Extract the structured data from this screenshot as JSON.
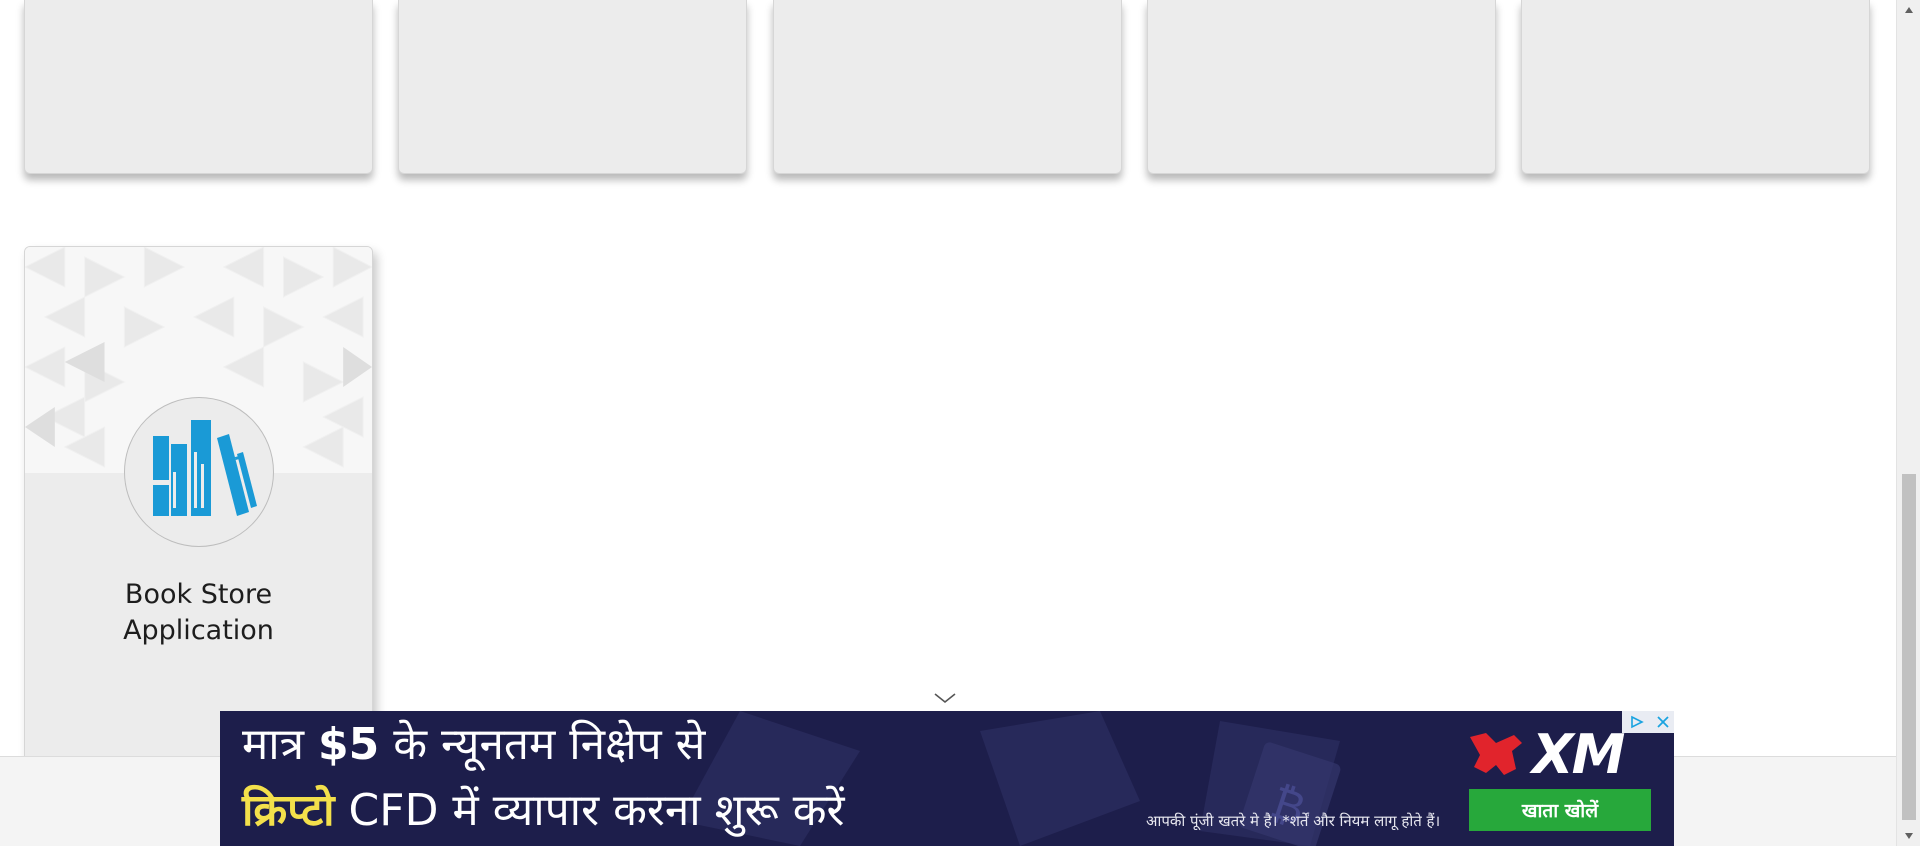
{
  "cards_top_row": [
    {
      "id": "card-1"
    },
    {
      "id": "card-2"
    },
    {
      "id": "card-3"
    },
    {
      "id": "card-4"
    },
    {
      "id": "card-5"
    }
  ],
  "book_card": {
    "title_line1": "Book Store",
    "title_line2": "Application",
    "icon": "books-icon",
    "icon_color": "#1a9ad6"
  },
  "ad": {
    "line1_prefix": "मात्र ",
    "line1_amount": "$5",
    "line1_suffix": " के न्यूनतम निक्षेप से",
    "line2_crypto": "क्रिप्टो",
    "line2_rest": " CFD में  व्यापार करना शुरू करें",
    "risk_text": "आपकी पूंजी खतरे मे है। *शर्तें और नियम लागू होते हैं।",
    "brand": "XM",
    "cta_label": "खाता खोलें",
    "background_color": "#1d1e4b",
    "cta_color": "#27a83b",
    "highlight_color": "#f3e04b",
    "adchoices_icon": "adchoices-icon",
    "close_icon": "close-icon"
  },
  "collapse_icon": "chevron-down-icon",
  "scrollbar": {
    "up_icon": "arrow-up-icon",
    "down_icon": "arrow-down-icon"
  }
}
